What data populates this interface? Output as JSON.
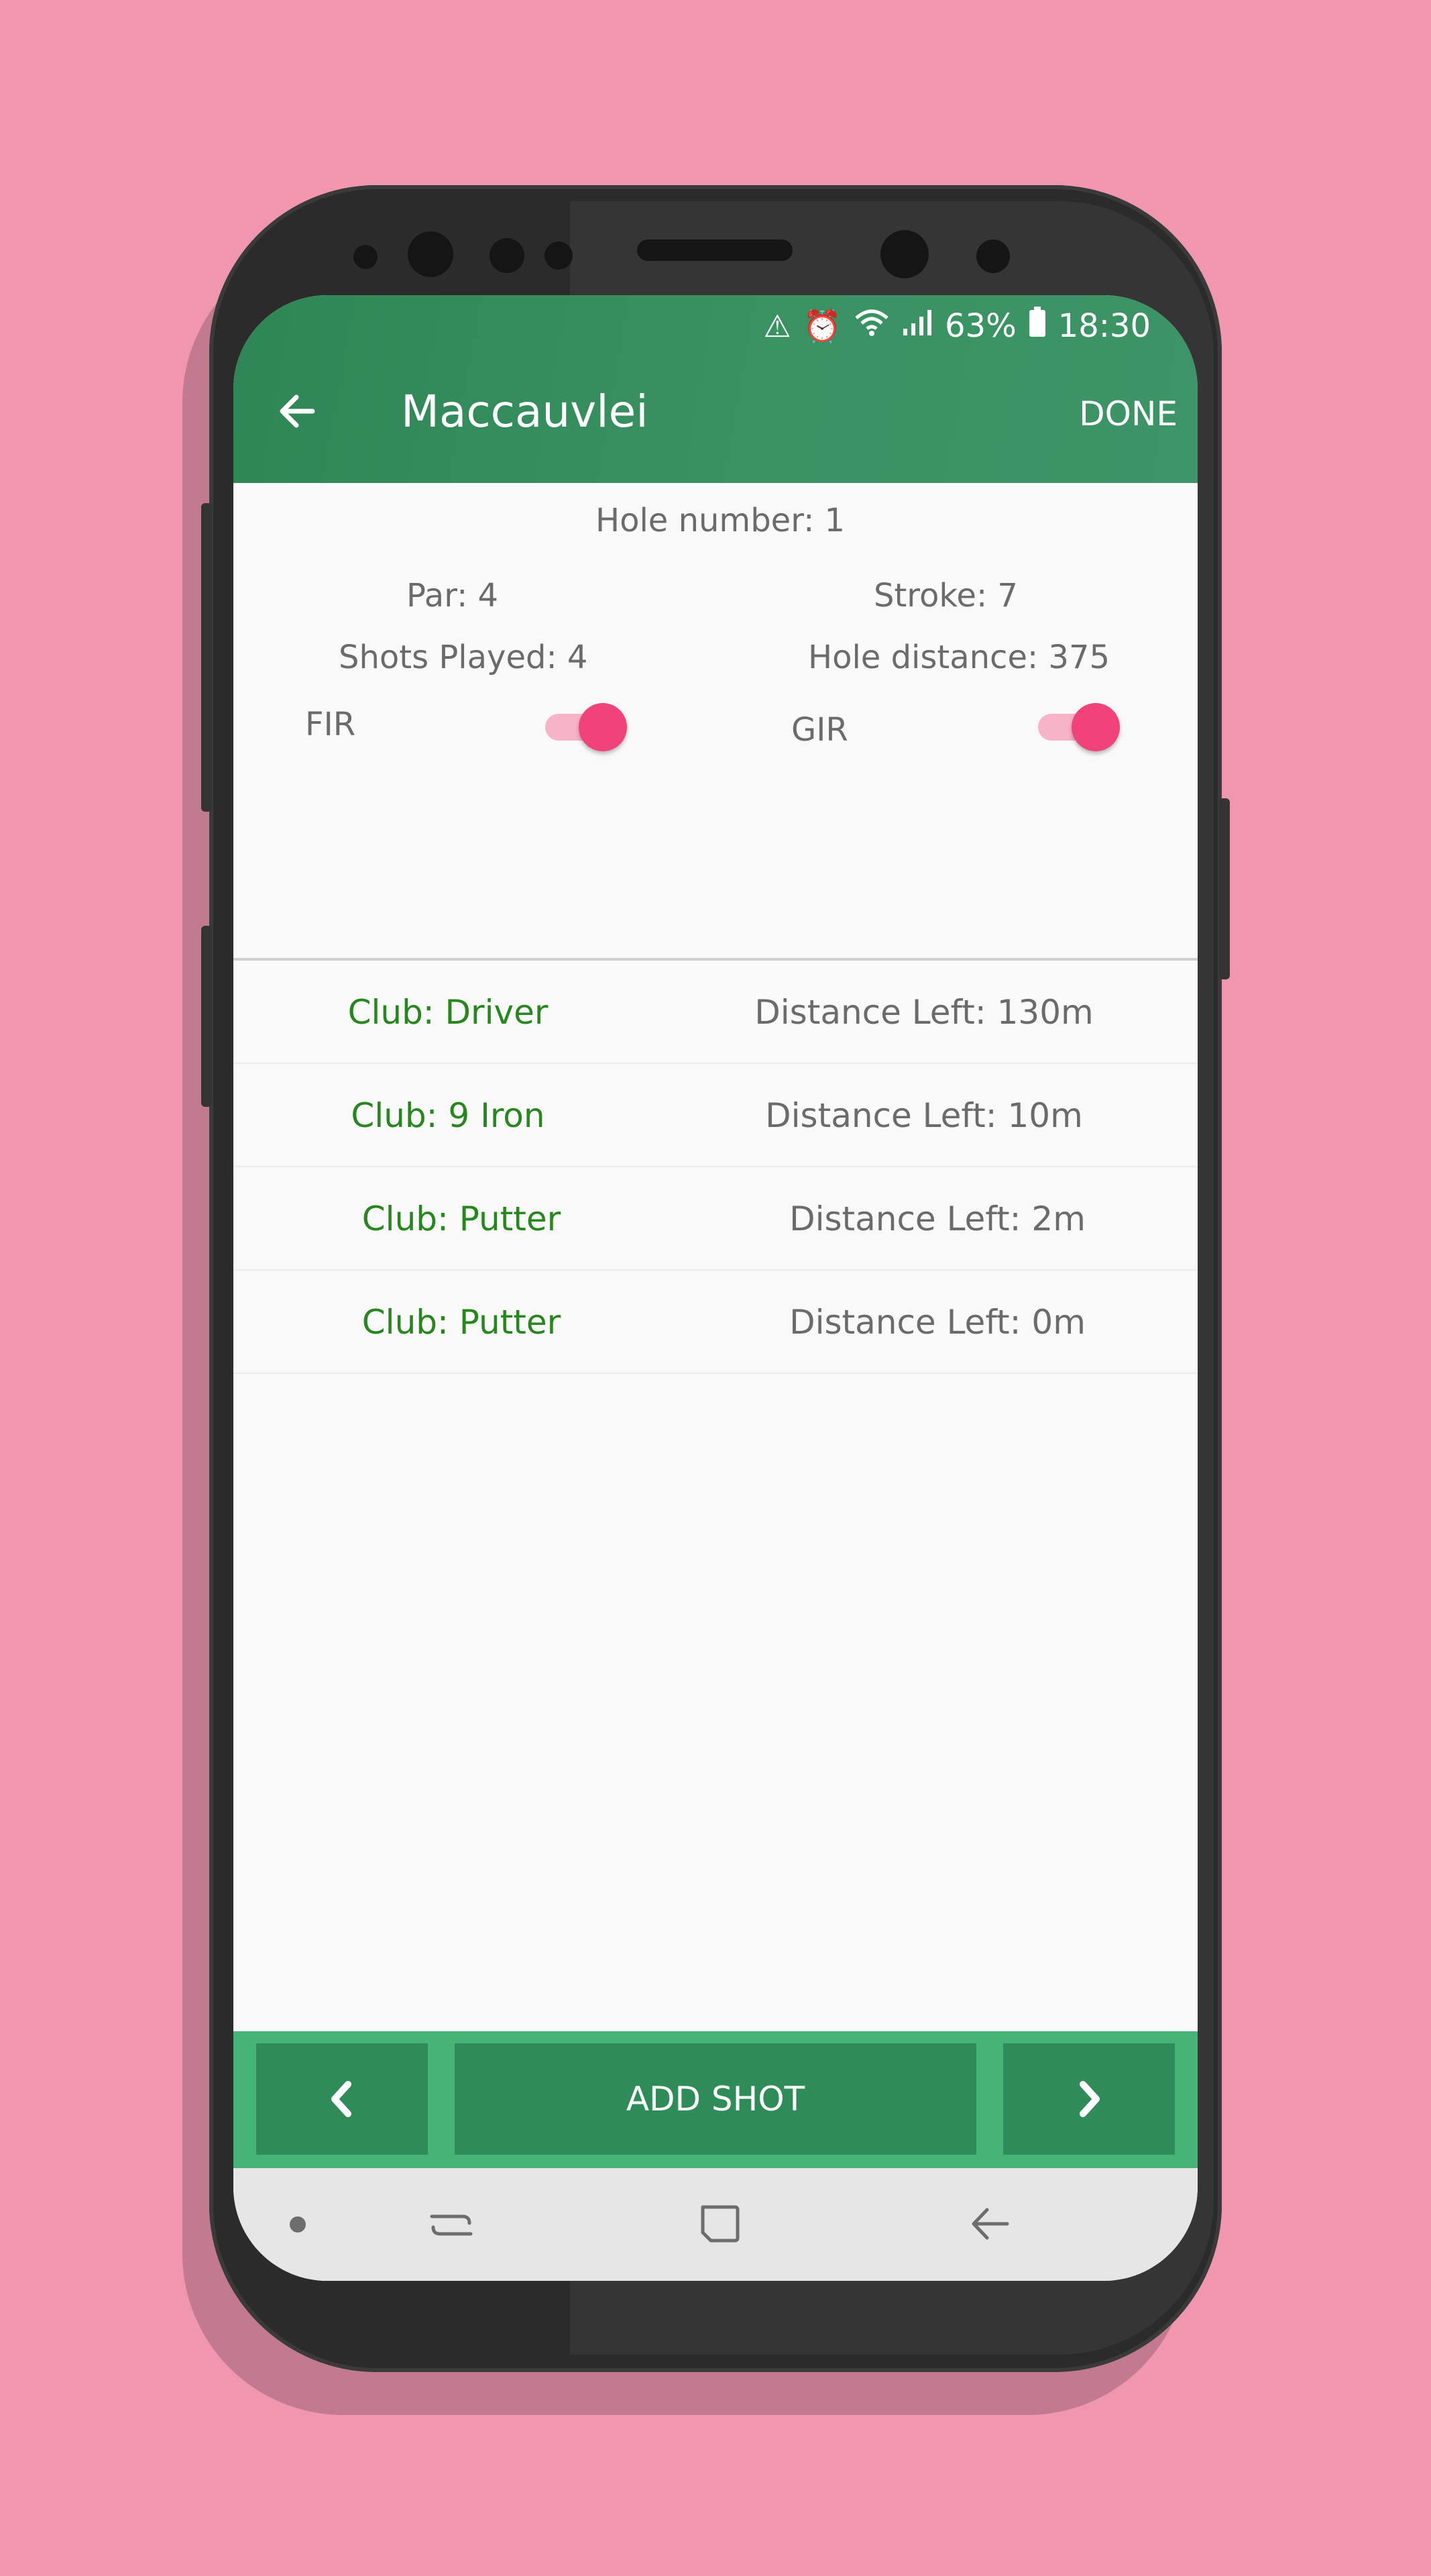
{
  "status_bar": {
    "icons": [
      "warning-icon",
      "alarm-icon",
      "wifi-icon",
      "signal-icon",
      "battery-icon"
    ],
    "battery": "63%",
    "time": "18:30"
  },
  "app_bar": {
    "title": "Maccauvlei",
    "done_label": "DONE"
  },
  "hole": {
    "hole_number": "Hole number:  1",
    "par": "Par:  4",
    "stroke": "Stroke:  7",
    "shots_played": "Shots Played:  4",
    "hole_distance": "Hole distance:  375",
    "fir_label": "FIR",
    "gir_label": "GIR",
    "fir_on": true,
    "gir_on": true
  },
  "shots": [
    {
      "club": "Club: Driver",
      "distance": "Distance Left: 130m"
    },
    {
      "club": "Club: 9 Iron",
      "distance": "Distance Left: 10m"
    },
    {
      "club": "Club: Putter",
      "distance": "Distance Left: 2m"
    },
    {
      "club": "Club: Putter",
      "distance": "Distance Left: 0m"
    }
  ],
  "bottom_bar": {
    "add_shot_label": "ADD SHOT"
  },
  "colors": {
    "app_bar": "#2e8655",
    "bottom_bar": "#46b476",
    "club_text": "#28861f",
    "toggle_accent": "#f0437a",
    "background": "#f097af"
  }
}
